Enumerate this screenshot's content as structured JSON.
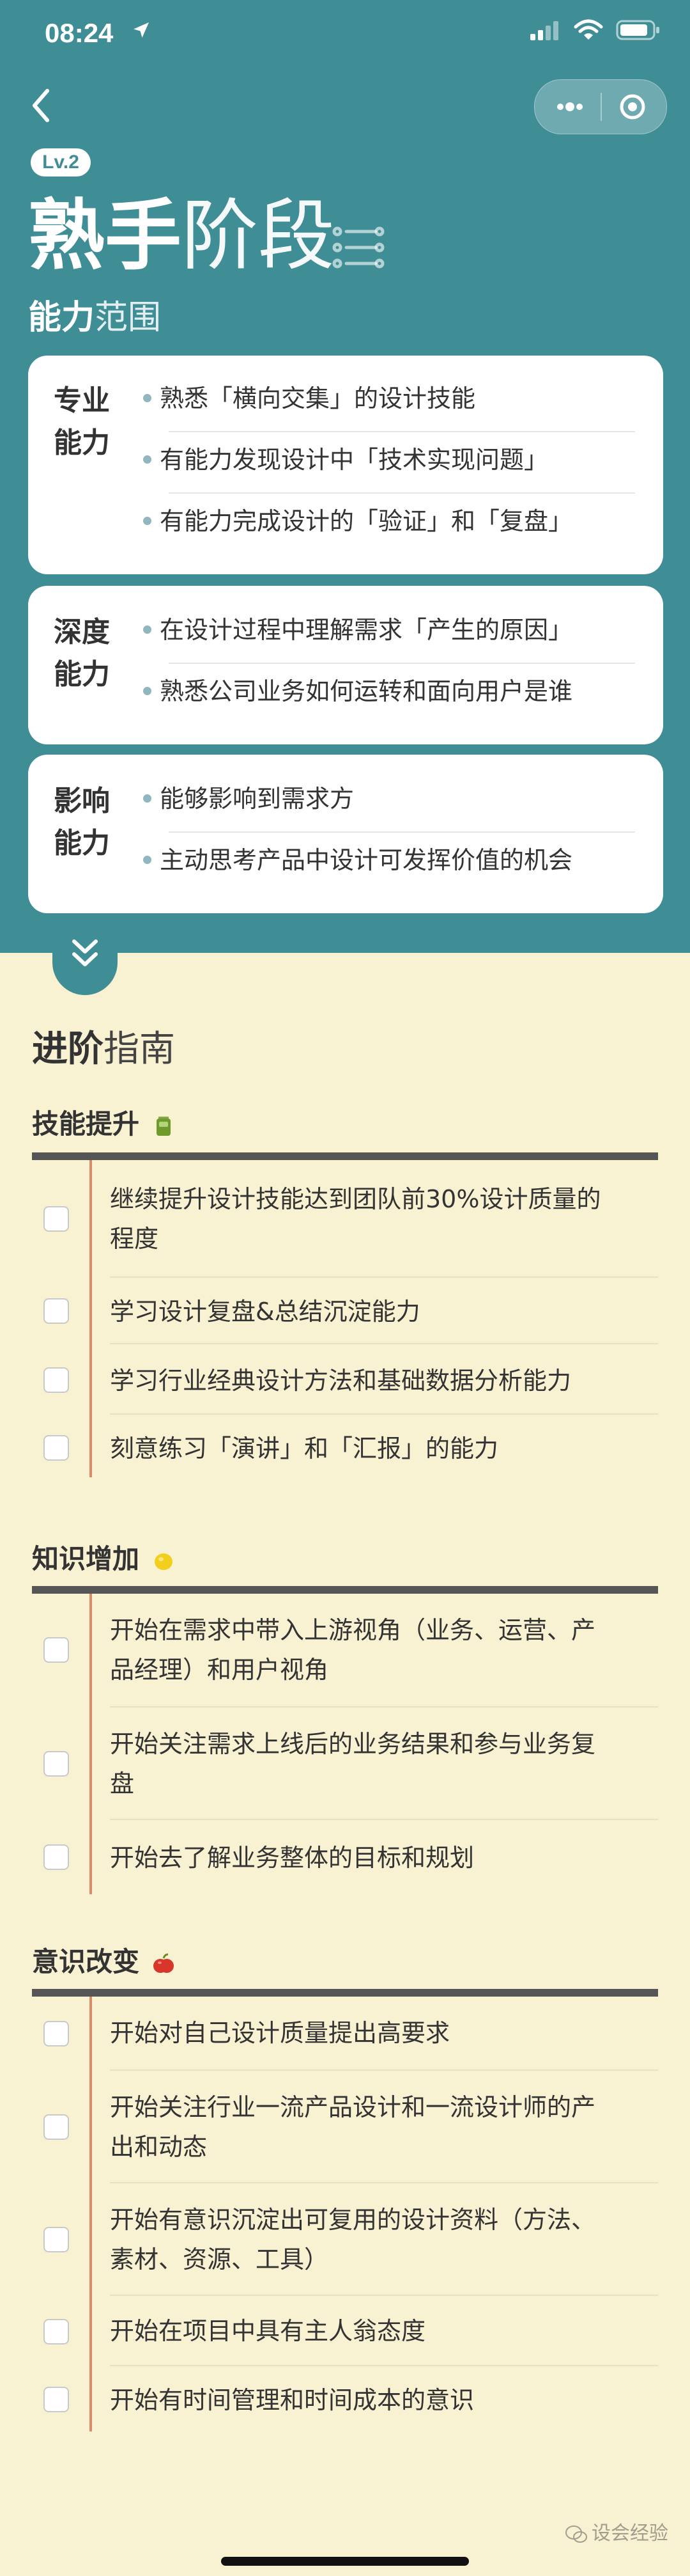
{
  "status": {
    "time": "08:24"
  },
  "header": {
    "level": "Lv.2",
    "title_bold": "熟手",
    "title_light": "阶段",
    "subtitle_bold": "能力",
    "subtitle_light": "范围"
  },
  "cards": [
    {
      "label_line1": "专业",
      "label_line2": "能力",
      "items": [
        "熟悉「横向交集」的设计技能",
        "有能力发现设计中「技术实现问题」",
        "有能力完成设计的「验证」和「复盘」"
      ]
    },
    {
      "label_line1": "深度",
      "label_line2": "能力",
      "items": [
        "在设计过程中理解需求「产生的原因」",
        "熟悉公司业务如何运转和面向用户是谁"
      ]
    },
    {
      "label_line1": "影响",
      "label_line2": "能力",
      "items": [
        "能够影响到需求方",
        "主动思考产品中设计可发挥价值的机会"
      ]
    }
  ],
  "guide": {
    "title_bold": "进阶",
    "title_light": "指南"
  },
  "sections": [
    {
      "title": "技能提升",
      "emoji": "battery-emoji",
      "items": [
        {
          "line1": "继续提升设计技能达到团队前30%设计质量的",
          "line2": "程度",
          "checked": false
        },
        {
          "line1": "学习设计复盘&总结沉淀能力",
          "line2": "",
          "checked": false
        },
        {
          "line1": "学习行业经典设计方法和基础数据分析能力",
          "line2": "",
          "checked": false
        },
        {
          "line1": "刻意练习「演讲」和「汇报」的能力",
          "line2": "",
          "checked": false
        }
      ]
    },
    {
      "title": "知识增加",
      "emoji": "lemon-emoji",
      "items": [
        {
          "line1": "开始在需求中带入上游视角（业务、运营、产",
          "line2": "品经理）和用户视角",
          "checked": false
        },
        {
          "line1": "开始关注需求上线后的业务结果和参与业务复",
          "line2": "盘",
          "checked": false
        },
        {
          "line1": "开始去了解业务整体的目标和规划",
          "line2": "",
          "checked": false
        }
      ]
    },
    {
      "title": "意识改变",
      "emoji": "apple-emoji",
      "items": [
        {
          "line1": "开始对自己设计质量提出高要求",
          "line2": "",
          "checked": false
        },
        {
          "line1": "开始关注行业一流产品设计和一流设计师的产",
          "line2": "出和动态",
          "checked": false
        },
        {
          "line1": "开始有意识沉淀出可复用的设计资料（方法、",
          "line2": "素材、资源、工具）",
          "checked": false
        },
        {
          "line1": "开始在项目中具有主人翁态度",
          "line2": "",
          "checked": false
        },
        {
          "line1": "开始有时间管理和时间成本的意识",
          "line2": "",
          "checked": false
        }
      ]
    }
  ],
  "watermark": "设会经验",
  "colors": {
    "header": "#3f8e96",
    "background": "#f8f1d2",
    "accent_line": "#d78d69",
    "bullet": "#8fb7bd"
  }
}
